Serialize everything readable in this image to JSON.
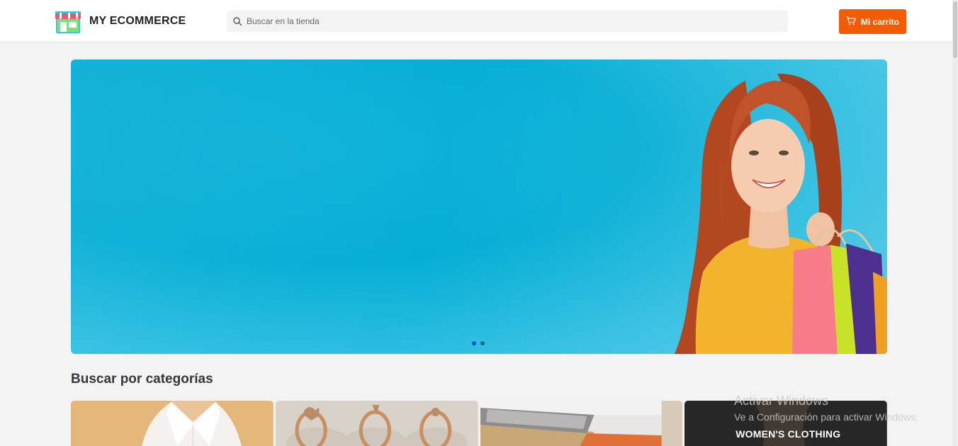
{
  "header": {
    "brand_name": "MY ECOMMERCE",
    "logo_icon": "storefront-icon",
    "search_placeholder": "Buscar en la tienda",
    "search_value": "",
    "search_icon": "search-icon",
    "cart_label": "Mi carrito",
    "cart_icon": "cart-icon"
  },
  "hero": {
    "slide_count": 2,
    "active_slide": 1,
    "background_color": "#06aed6"
  },
  "categories": {
    "title": "Buscar por categorías",
    "items": [
      {
        "label": ""
      },
      {
        "label": ""
      },
      {
        "label": ""
      },
      {
        "label": "WOMEN'S CLOTHING"
      }
    ]
  },
  "watermark": {
    "title": "Activar Windows",
    "subtitle": "Ve a Configuración para activar Windows."
  },
  "colors": {
    "accent": "#f25c05",
    "text_dark": "#222222",
    "page_bg": "#f3f3f3"
  }
}
